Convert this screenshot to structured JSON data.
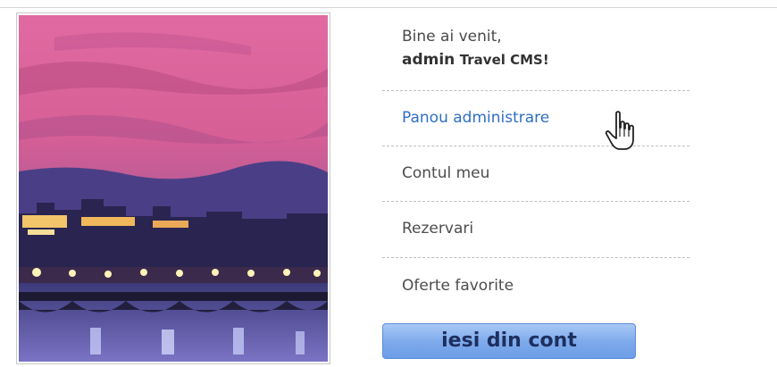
{
  "welcome": {
    "greeting": "Bine ai venit,",
    "username": "admin",
    "site_name": "Travel CMS!"
  },
  "menu": {
    "items": [
      {
        "label": "Panou administrare"
      },
      {
        "label": "Contul meu"
      },
      {
        "label": "Rezervari"
      },
      {
        "label": "Oferte favorite"
      }
    ]
  },
  "logout": {
    "label": "iesi din cont"
  },
  "colors": {
    "link_active": "#2f6fc1",
    "button_blue": "#7fabec"
  },
  "icons": {
    "cursor": "hand-pointer-icon"
  }
}
